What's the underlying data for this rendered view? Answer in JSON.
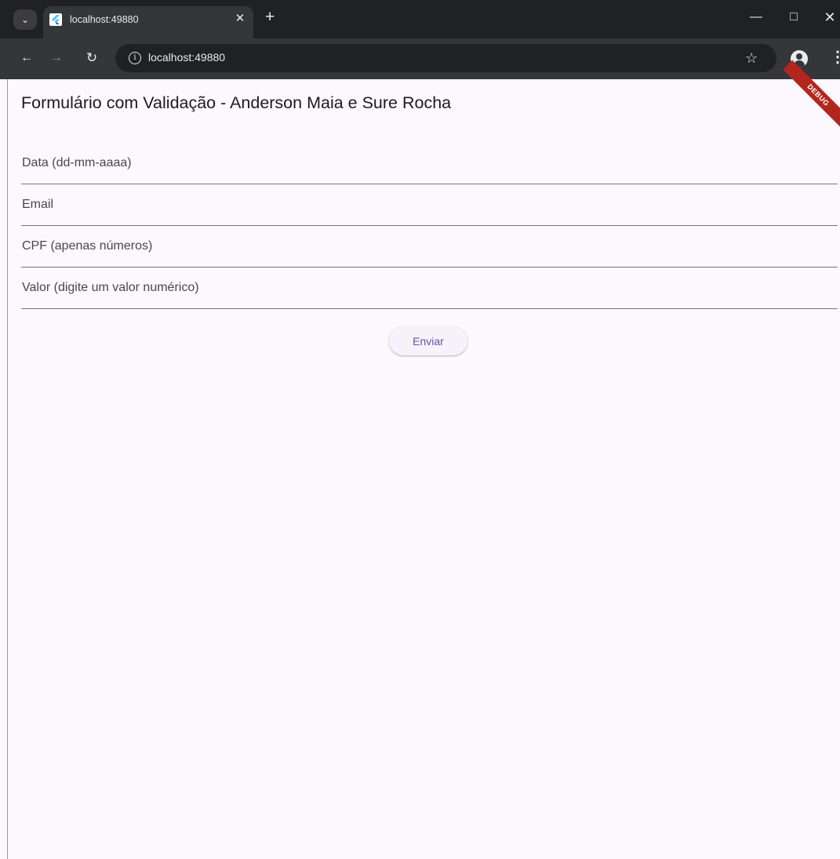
{
  "browser": {
    "tab_title": "localhost:49880",
    "url": "localhost:49880",
    "icons": {
      "tab_menu": "chevron-down-icon",
      "favicon": "flutter-icon",
      "tab_close": "close-icon",
      "new_tab": "plus-icon",
      "back": "arrow-left-icon",
      "forward": "arrow-right-icon",
      "reload": "reload-icon",
      "site_info": "info-icon",
      "bookmark": "star-icon",
      "profile": "profile-icon",
      "menu": "kebab-icon"
    }
  },
  "app": {
    "title": "Formulário com Validação - Anderson Maia e Sure Rocha",
    "debug_banner": "DEBUG",
    "fields": [
      {
        "placeholder": "Data (dd-mm-aaaa)",
        "value": ""
      },
      {
        "placeholder": "Email",
        "value": ""
      },
      {
        "placeholder": "CPF (apenas números)",
        "value": ""
      },
      {
        "placeholder": "Valor (digite um valor numérico)",
        "value": ""
      }
    ],
    "submit_label": "Enviar"
  },
  "colors": {
    "page_background": "#fdf7fe",
    "button_text": "#6750a4",
    "debug_banner": "#b3261e",
    "browser_frame": "#202124",
    "browser_toolbar": "#35363a"
  }
}
